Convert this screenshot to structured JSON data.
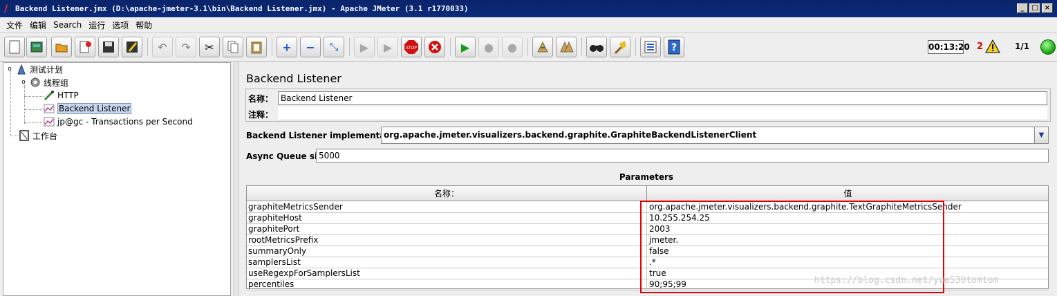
{
  "window": {
    "title": "Backend Listener.jmx (D:\\apache-jmeter-3.1\\bin\\Backend Listener.jmx) - Apache JMeter (3.1 r1770033)"
  },
  "menu": [
    "文件",
    "编辑",
    "Search",
    "运行",
    "选项",
    "帮助"
  ],
  "toolbar": {
    "timer": "00:13:20",
    "error_count": "2",
    "threads": "1/1"
  },
  "tree": {
    "nodes": [
      {
        "label": "测试计划"
      },
      {
        "label": "线程组"
      },
      {
        "label": "HTTP"
      },
      {
        "label": "Backend Listener"
      },
      {
        "label": "jp@gc - Transactions per Second"
      },
      {
        "label": "工作台"
      }
    ]
  },
  "panel": {
    "title": "Backend Listener",
    "name_label": "名称：",
    "name_value": "Backend Listener",
    "comment_label": "注释：",
    "comment_value": "",
    "impl_label": "Backend Listener implementation",
    "impl_value": "org.apache.jmeter.visualizers.backend.graphite.GraphiteBackendListenerClient",
    "queue_label": "Async Queue size",
    "queue_value": "5000",
    "params_title": "Parameters",
    "col_name": "名称：",
    "col_value": "值",
    "params": [
      {
        "name": "graphiteMetricsSender",
        "value": "org.apache.jmeter.visualizers.backend.graphite.TextGraphiteMetricsSender"
      },
      {
        "name": "graphiteHost",
        "value": "10.255.254.25"
      },
      {
        "name": "graphitePort",
        "value": "2003"
      },
      {
        "name": "rootMetricsPrefix",
        "value": "jmeter."
      },
      {
        "name": "summaryOnly",
        "value": "false"
      },
      {
        "name": "samplersList",
        "value": ".*"
      },
      {
        "name": "useRegexpForSamplersList",
        "value": "true"
      },
      {
        "name": "percentiles",
        "value": "90;95;99"
      }
    ]
  },
  "watermark": "https://blog.csdn.net/yue530tomtom"
}
